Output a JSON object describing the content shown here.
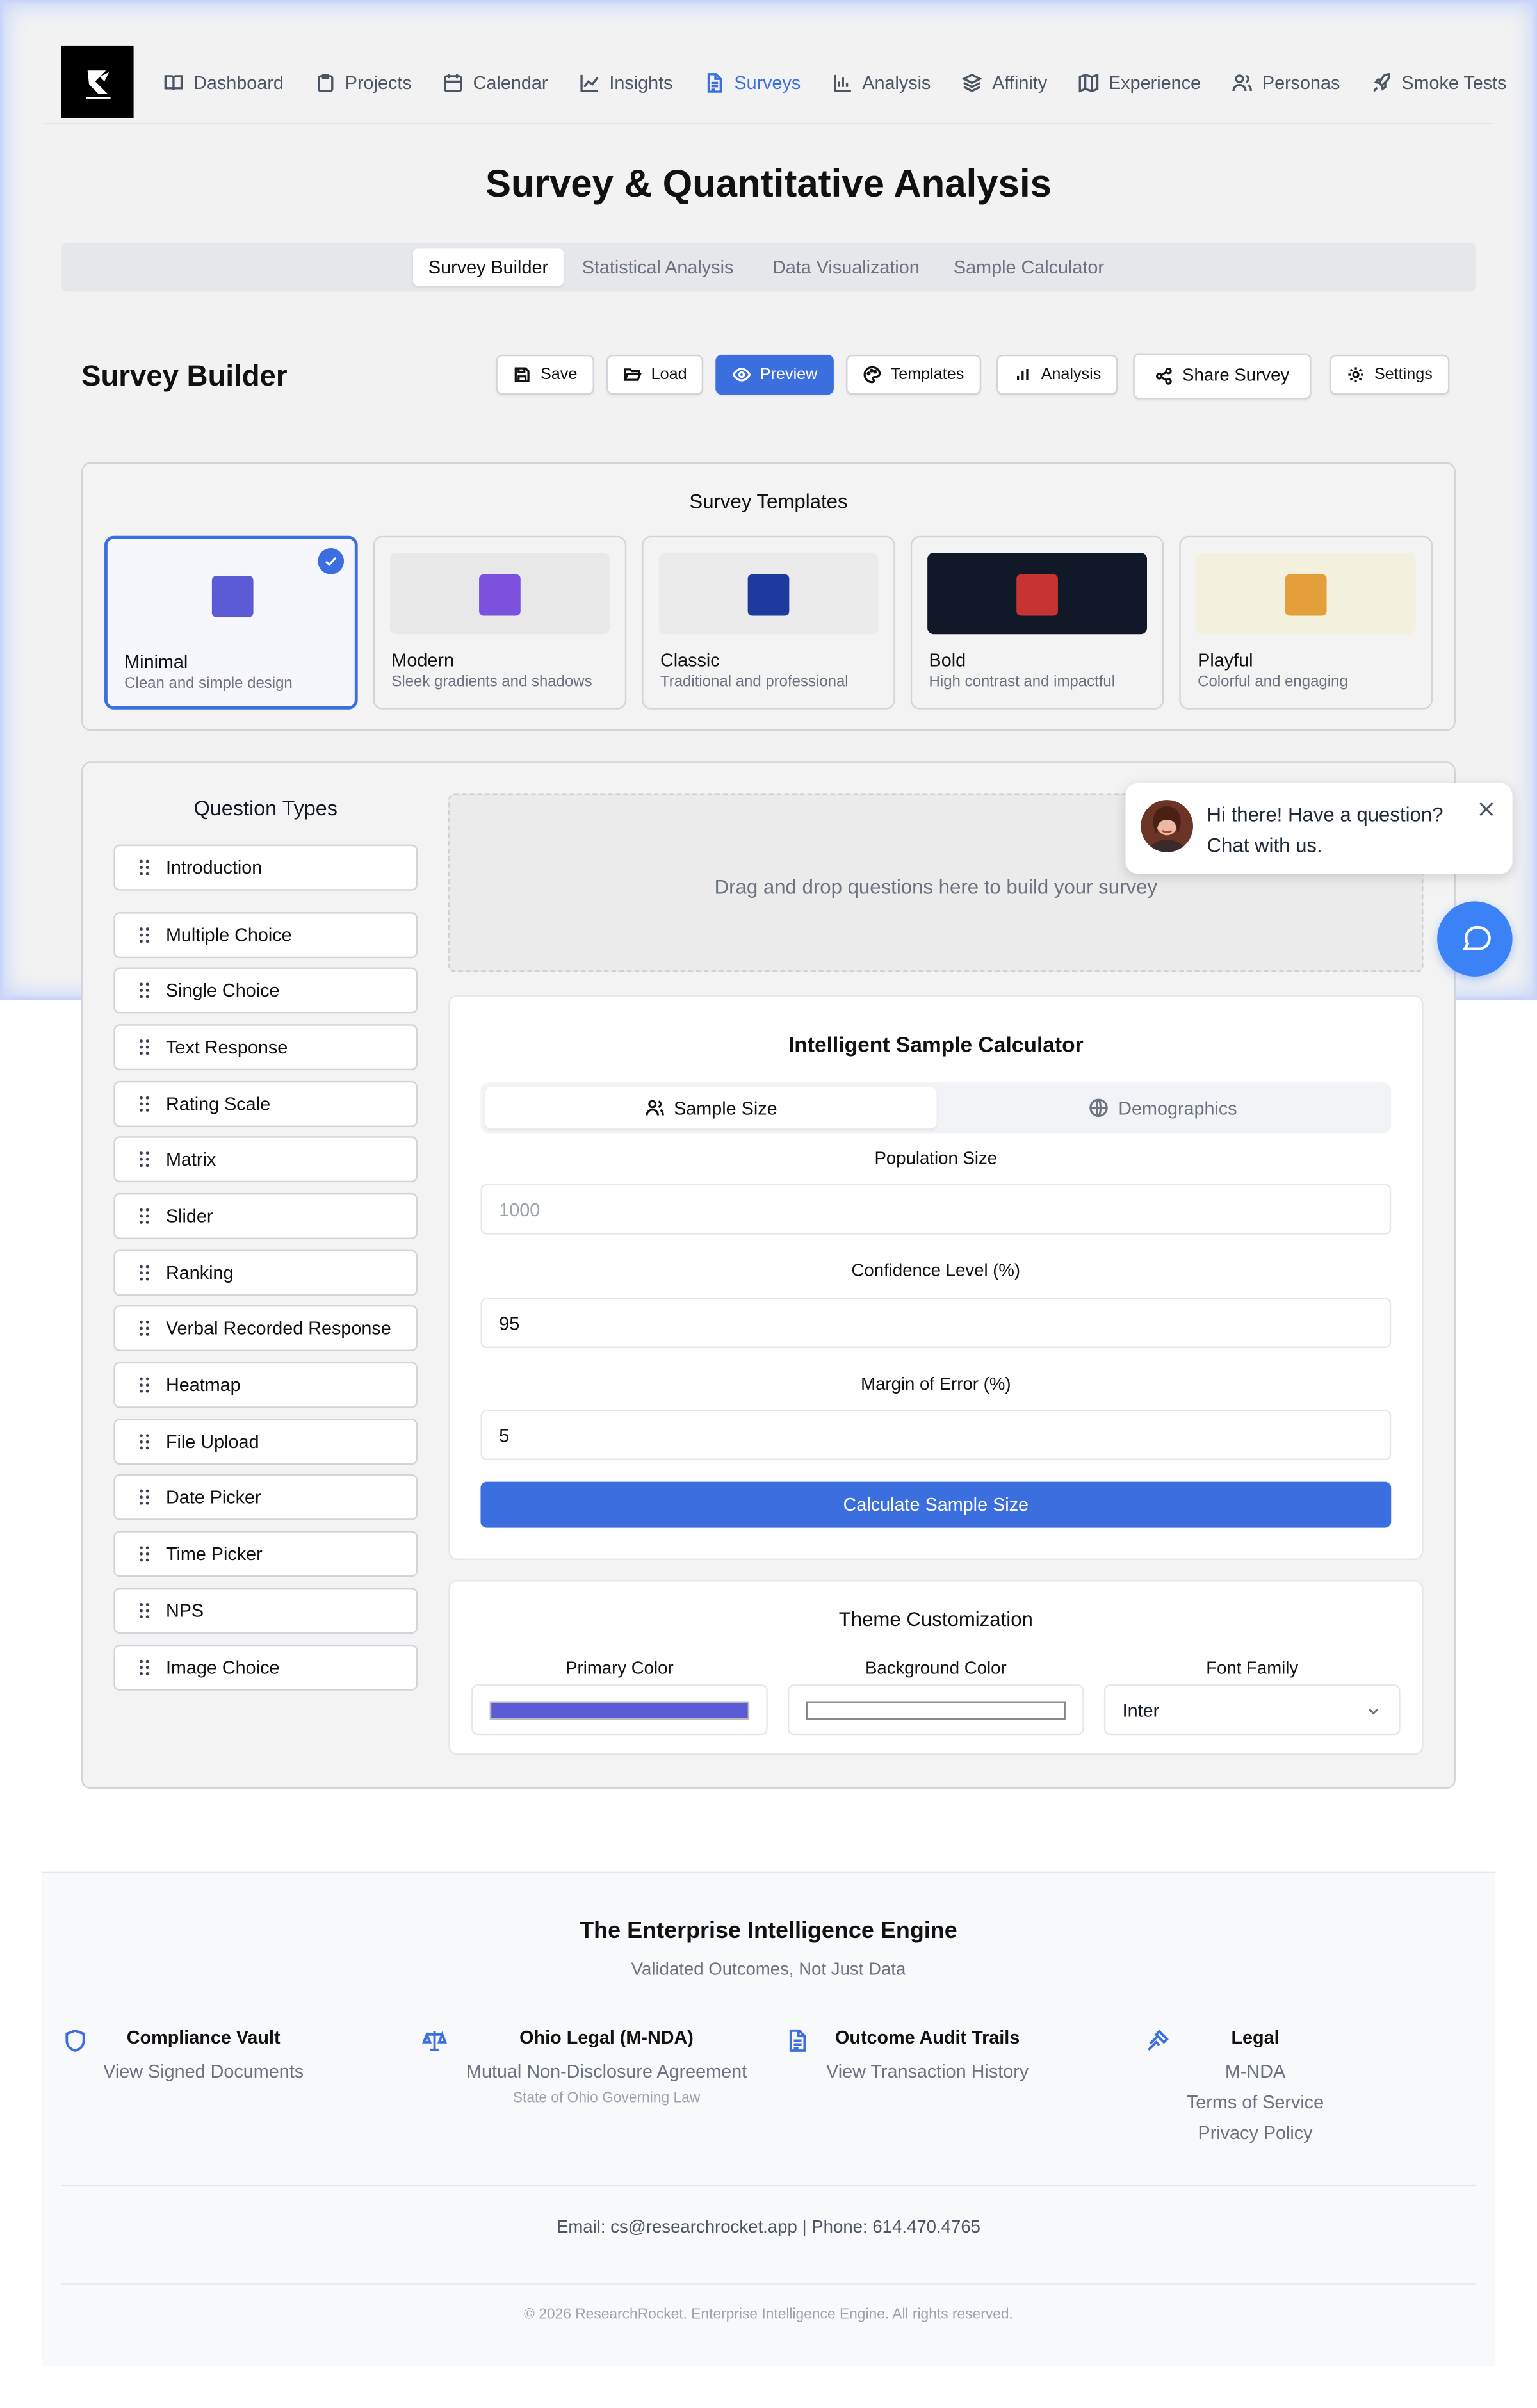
{
  "nav": {
    "logo_icon": "research-rocket-logo",
    "items": [
      {
        "label": "Dashboard",
        "icon": "book-icon"
      },
      {
        "label": "Projects",
        "icon": "clipboard-icon"
      },
      {
        "label": "Calendar",
        "icon": "calendar-icon"
      },
      {
        "label": "Insights",
        "icon": "line-chart-icon"
      },
      {
        "label": "Surveys",
        "icon": "file-text-icon",
        "active": true
      },
      {
        "label": "Analysis",
        "icon": "bar-chart-icon"
      },
      {
        "label": "Affinity",
        "icon": "layers-icon"
      },
      {
        "label": "Experience",
        "icon": "map-icon"
      },
      {
        "label": "Personas",
        "icon": "users-icon"
      },
      {
        "label": "Smoke Tests",
        "icon": "rocket-icon"
      }
    ]
  },
  "page_title": "Survey & Quantitative Analysis",
  "tabs": [
    "Survey Builder",
    "Statistical Analysis",
    "Data Visualization",
    "Sample Calculator"
  ],
  "builder": {
    "title": "Survey Builder",
    "toolbar": {
      "save": "Save",
      "load": "Load",
      "preview": "Preview",
      "templates": "Templates",
      "analysis": "Analysis",
      "share": "Share Survey",
      "settings": "Settings"
    }
  },
  "templates": {
    "title": "Survey Templates",
    "items": [
      {
        "name": "Minimal",
        "desc": "Clean and simple design",
        "preview_bg": "#f5f7fc",
        "swatch": "#5b5bd6",
        "selected": true
      },
      {
        "name": "Modern",
        "desc": "Sleek gradients and shadows",
        "preview_bg": "#e8e8e8",
        "swatch": "#7b52dd"
      },
      {
        "name": "Classic",
        "desc": "Traditional and professional",
        "preview_bg": "#ebebeb",
        "swatch": "#1e3a9e"
      },
      {
        "name": "Bold",
        "desc": "High contrast and impactful",
        "preview_bg": "#111827",
        "swatch": "#c73331"
      },
      {
        "name": "Playful",
        "desc": "Colorful and engaging",
        "preview_bg": "#f3f1dd",
        "swatch": "#e39f3a"
      }
    ]
  },
  "question_types": {
    "title": "Question Types",
    "items": [
      "Introduction",
      "Multiple Choice",
      "Single Choice",
      "Text Response",
      "Rating Scale",
      "Matrix",
      "Slider",
      "Ranking",
      "Verbal Recorded Response",
      "Heatmap",
      "File Upload",
      "Date Picker",
      "Time Picker",
      "NPS",
      "Image Choice"
    ]
  },
  "dropzone": {
    "text": "Drag and drop questions here to build your survey"
  },
  "chat": {
    "line1": "Hi there! Have a question?",
    "line2": "Chat with us."
  },
  "calculator": {
    "title": "Intelligent Sample Calculator",
    "tab_sample": "Sample Size",
    "tab_demographics": "Demographics",
    "population_label": "Population Size",
    "population_placeholder": "1000",
    "confidence_label": "Confidence Level (%)",
    "confidence_value": "95",
    "margin_label": "Margin of Error (%)",
    "margin_value": "5",
    "button": "Calculate Sample Size"
  },
  "theme": {
    "title": "Theme Customization",
    "primary_label": "Primary Color",
    "primary_color": "#5b5bd6",
    "background_label": "Background Color",
    "background_color": "#ffffff",
    "font_label": "Font Family",
    "font_value": "Inter"
  },
  "footer": {
    "title": "The Enterprise Intelligence Engine",
    "subtitle": "Validated Outcomes, Not Just Data",
    "cols": [
      {
        "heading": "Compliance Vault",
        "links": [
          "View Signed Documents"
        ],
        "icon": "shield-icon"
      },
      {
        "heading": "Ohio Legal (M-NDA)",
        "links": [
          "Mutual Non-Disclosure Agreement"
        ],
        "small": "State of Ohio Governing Law",
        "icon": "scale-icon"
      },
      {
        "heading": "Outcome Audit Trails",
        "links": [
          "View Transaction History"
        ],
        "icon": "document-icon"
      },
      {
        "heading": "Legal",
        "links": [
          "M-NDA",
          "Terms of Service",
          "Privacy Policy"
        ],
        "icon": "gavel-icon"
      }
    ],
    "contact": "Email: cs@researchrocket.app | Phone: 614.470.4765",
    "copyright": "© 2026 ResearchRocket. Enterprise Intelligence Engine. All rights reserved."
  },
  "colors": {
    "accent": "#3b6fe0"
  }
}
